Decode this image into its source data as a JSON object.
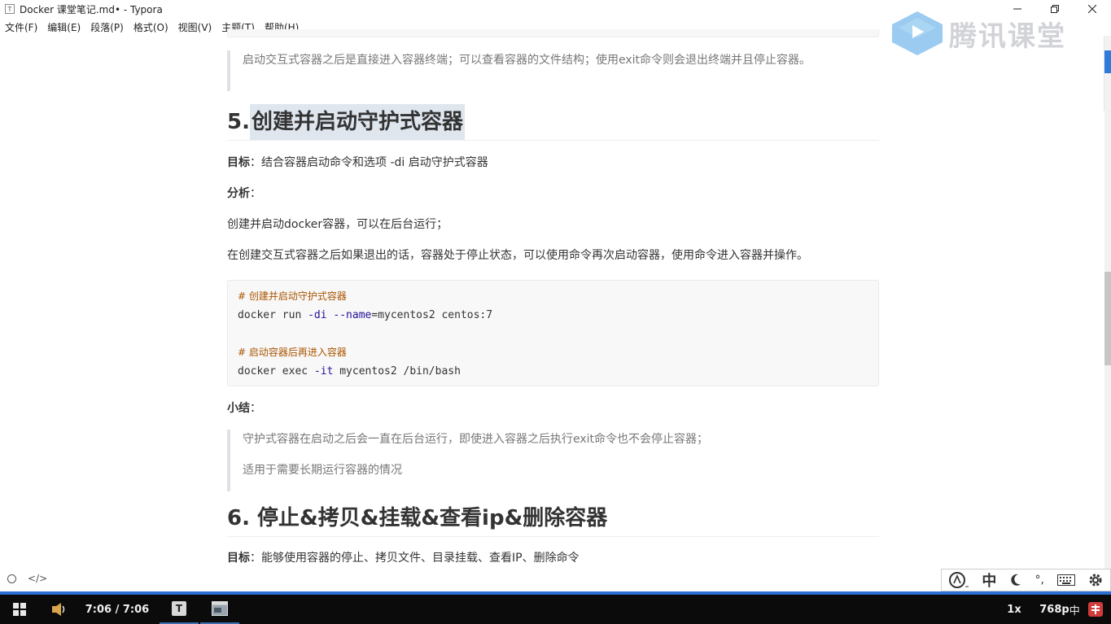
{
  "window": {
    "title": "Docker 课堂笔记.md• - Typora",
    "icon_letter": "T"
  },
  "menu": [
    "文件(F)",
    "编辑(E)",
    "段落(P)",
    "格式(O)",
    "视图(V)",
    "主题(T)",
    "帮助(H)"
  ],
  "watermark": {
    "text": "腾讯课堂"
  },
  "content": {
    "quote1": "启动交互式容器之后是直接进入容器终端；可以查看容器的文件结构；使用exit命令则会退出终端并且停止容器。",
    "h5_num": "5.",
    "h5_title": "创建并启动守护式容器",
    "goal_label": "目标",
    "goal_text": "：结合容器启动命令和选项 -di 启动守护式容器",
    "analysis_label": "分析",
    "analysis_colon": "：",
    "p1": "创建并启动docker容器，可以在后台运行；",
    "p2": "在创建交互式容器之后如果退出的话，容器处于停止状态，可以使用命令再次启动容器，使用命令进入容器并操作。",
    "code": {
      "c1": "# 创建并启动守护式容器",
      "l1_cmd": "docker run ",
      "l1_opt1": "-di",
      "l1_sp": " ",
      "l1_opt2": "--name",
      "l1_rest": "=mycentos2 centos:7",
      "c2": "# 启动容器后再进入容器",
      "l2_cmd": "docker exec ",
      "l2_opt": "-it",
      "l2_rest": " mycentos2 /bin/bash"
    },
    "summary_label": "小结",
    "summary_colon": "：",
    "quote2_l1": "守护式容器在启动之后会一直在后台运行，即使进入容器之后执行exit命令也不会停止容器；",
    "quote2_l2": "适用于需要长期运行容器的情况",
    "h6": "6. 停止&拷贝&挂载&查看ip&删除容器",
    "goal2_label": "目标",
    "goal2_text": "：能够使用容器的停止、拷贝文件、目录挂载、查看IP、删除命令"
  },
  "editor_status": {
    "source_toggle": "</>"
  },
  "ime": {
    "mode": "中",
    "punct": "°,"
  },
  "taskbar": {
    "time": "7:06 / 7:06",
    "speed": "1x",
    "resolution": "768p",
    "lang": "中"
  }
}
